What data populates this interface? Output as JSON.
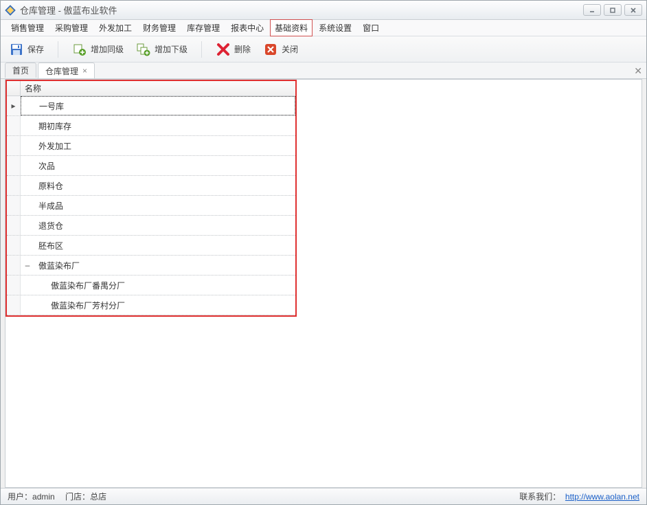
{
  "window": {
    "title": "仓库管理 - 傲蓝布业软件"
  },
  "menu": {
    "items": [
      "销售管理",
      "采购管理",
      "外发加工",
      "财务管理",
      "库存管理",
      "报表中心",
      "基础资料",
      "系统设置",
      "窗口"
    ],
    "highlighted_index": 6
  },
  "toolbar": {
    "save": "保存",
    "add_sibling": "增加同级",
    "add_child": "增加下级",
    "delete": "删除",
    "close": "关闭"
  },
  "tabs": {
    "items": [
      {
        "label": "首页",
        "closable": false,
        "active": false
      },
      {
        "label": "仓库管理",
        "closable": true,
        "active": true
      }
    ]
  },
  "grid": {
    "header": "名称",
    "rows": [
      {
        "label": "一号库",
        "selected": true,
        "level": 0
      },
      {
        "label": "期初库存",
        "level": 0
      },
      {
        "label": "外发加工",
        "level": 0
      },
      {
        "label": "次品",
        "level": 0
      },
      {
        "label": "原料仓",
        "level": 0
      },
      {
        "label": "半成品",
        "level": 0
      },
      {
        "label": "退货仓",
        "level": 0
      },
      {
        "label": "胚布区",
        "level": 0
      },
      {
        "label": "傲蓝染布厂",
        "level": 0,
        "expander": "-"
      },
      {
        "label": "傲蓝染布厂番禺分厂",
        "level": 1
      },
      {
        "label": "傲蓝染布厂芳村分厂",
        "level": 1
      }
    ]
  },
  "status": {
    "user_label": "用户：",
    "user": "admin",
    "store_label": "门店：",
    "store": "总店",
    "contact_label": "联系我们：",
    "link_text": "http://www.aolan.net"
  }
}
